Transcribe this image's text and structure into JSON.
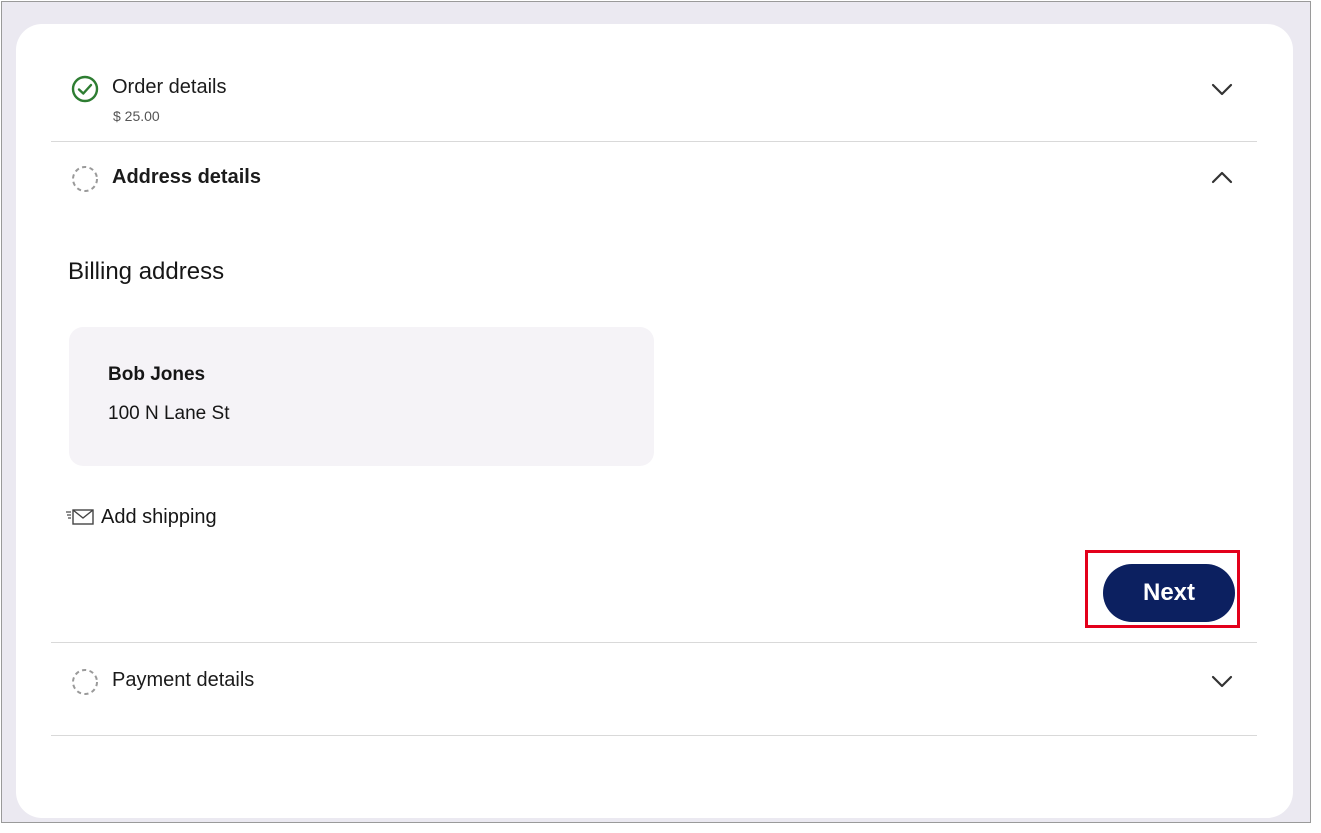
{
  "sections": {
    "order": {
      "title": "Order details",
      "subtitle": "$ 25.00",
      "status_icon": "check-circle-icon",
      "chevron_icon": "chevron-down-icon",
      "status_color": "#2e7d32"
    },
    "address": {
      "title": "Address details",
      "status_icon": "dashed-circle-icon",
      "chevron_icon": "chevron-up-icon",
      "billing_title": "Billing address",
      "billing": {
        "name": "Bob Jones",
        "street": "100 N Lane St"
      },
      "add_shipping_label": "Add shipping",
      "add_shipping_icon": "envelope-icon",
      "next_label": "Next"
    },
    "payment": {
      "title": "Payment details",
      "status_icon": "dashed-circle-icon",
      "chevron_icon": "chevron-down-icon"
    }
  },
  "colors": {
    "primary_button": "#0c2060",
    "highlight": "#e3001b",
    "address_card_bg": "#f5f3f7"
  }
}
